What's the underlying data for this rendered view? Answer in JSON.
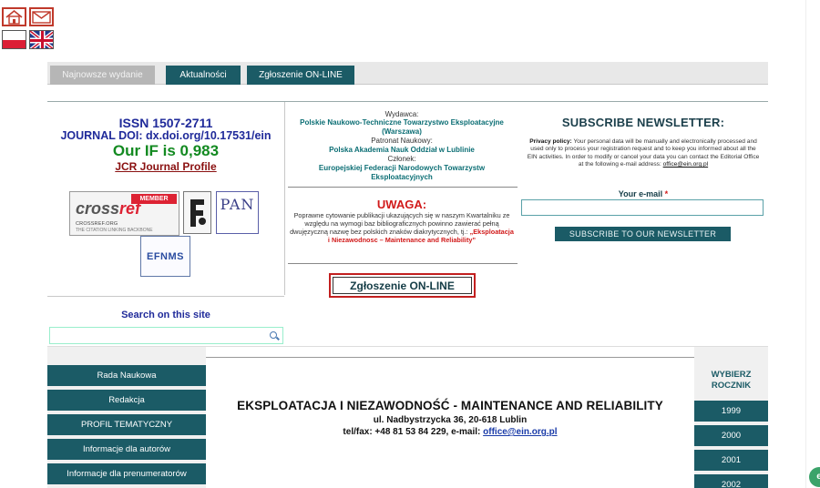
{
  "header": {
    "icons": [
      "home-icon",
      "mail-icon"
    ],
    "flags": [
      "flag-pl-icon",
      "flag-uk-icon"
    ]
  },
  "tabs": [
    {
      "label": "Najnowsze wydanie",
      "active": true
    },
    {
      "label": "Aktualności",
      "active": false
    },
    {
      "label": "Zgłoszenie ON-LINE",
      "active": false
    }
  ],
  "journal": {
    "issn": "ISSN 1507-2711",
    "doi": "JOURNAL DOI: dx.doi.org/10.17531/ein",
    "impact_factor": "Our IF is 0,983",
    "jcr_link": "JCR Journal Profile"
  },
  "logos": {
    "crossref_member": "MEMBER",
    "crossref_word_a": "cross",
    "crossref_word_b": "ref",
    "crossref_site": "CROSSREF.ORG",
    "crossref_tagline": "THE CITATION LINKING BACKBONE",
    "pan": "PAN",
    "efnms": "EFNMS"
  },
  "publisher": {
    "wydawca_label": "Wydawca:",
    "wydawca_name": "Polskie Naukowo-Techniczne Towarzystwo Eksploatacyjne (Warszawa)",
    "patronat_label": "Patronat Naukowy:",
    "patronat_name": "Polska Akademia Nauk Oddział w Lublinie",
    "czlonek_label": "Członek:",
    "czlonek_name": "Europejskiej Federacji Narodowych Towarzystw Eksploatacyjnych"
  },
  "notice": {
    "title": "UWAGA:",
    "text": "Poprawne cytowanie publikacji ukazujących się w naszym Kwartalniku ze względu na wymogi baz bibliograficznych powinno zawierać pełną dwujęzyczną nazwę bez polskich znaków diakrytycznych, tj.:",
    "highlight": "„Eksploatacja i Niezawodnosc – Maintenance and Reliability”"
  },
  "online_button": "Zgłoszenie ON-LINE",
  "search": {
    "title": "Search on this site",
    "placeholder": ""
  },
  "newsletter": {
    "title": "SUBSCRIBE NEWSLETTER:",
    "policy_label": "Privacy policy:",
    "policy_text": "Your personal data will be manually and electronically processed and used only to process your registration request and to keep you informed about all the EIN activities. In order to modify or cancel your data you can contact the Editorial Office at the following e-mail address:",
    "policy_email": "office@ein.org.pl",
    "email_label": "Your e-mail",
    "required_mark": "*",
    "email_value": "",
    "button": "SUBSCRIBE TO OUR NEWSLETTER"
  },
  "left_nav": [
    "Rada Naukowa",
    "Redakcja",
    "PROFIL TEMATYCZNY",
    "Informacje dla autorów",
    "Informacje dla prenumeratorów"
  ],
  "center": {
    "title": "EKSPLOATACJA I NIEZAWODNOŚĆ - MAINTENANCE AND RELIABILITY",
    "address": "ul. Nadbystrzycka 36, 20-618 Lublin",
    "contact_prefix": "tel/fax: +48 81 53 84 229, e-mail:",
    "contact_email": "office@ein.org.pl"
  },
  "year_select": {
    "title_line1": "WYBIERZ",
    "title_line2": "ROCZNIK",
    "years": [
      "1999",
      "2000",
      "2001",
      "2002"
    ]
  },
  "colors": {
    "teal": "#1b5b66",
    "navy": "#1f2a9a",
    "green": "#138a21",
    "red": "#d11a1a"
  }
}
